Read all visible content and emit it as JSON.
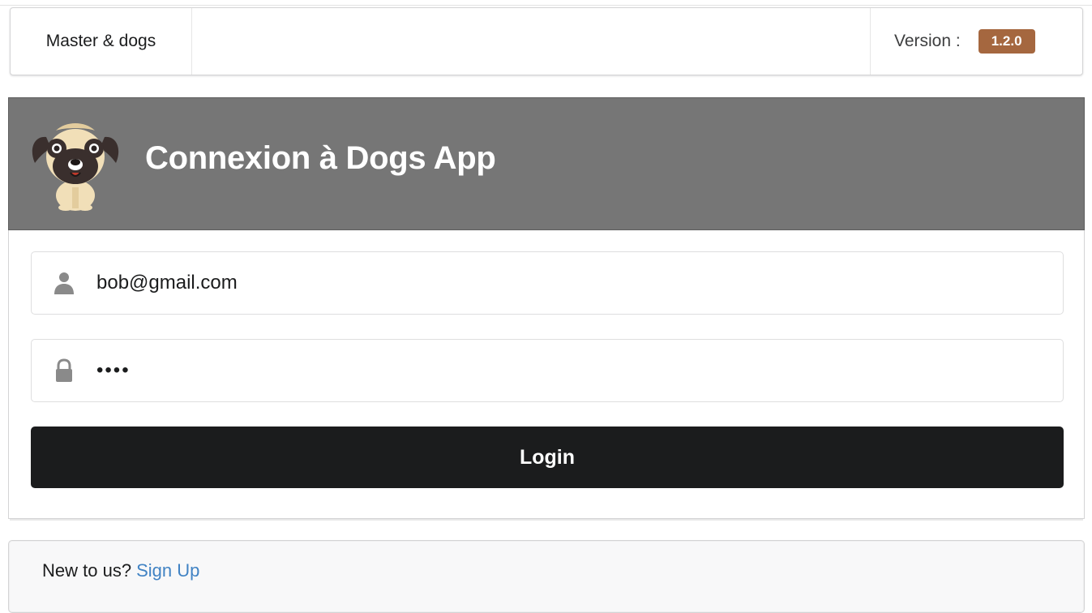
{
  "menu": {
    "brand": "Master & dogs",
    "version_label": "Version :",
    "version_value": "1.2.0"
  },
  "header": {
    "title": "Connexion à Dogs App",
    "logo_icon": "pug-logo"
  },
  "form": {
    "email": {
      "value": "bob@gmail.com",
      "icon": "user-icon"
    },
    "password": {
      "value": "abcd",
      "icon": "lock-icon"
    },
    "login_label": "Login"
  },
  "message": {
    "text": "New to us?",
    "link_label": "Sign Up"
  },
  "colors": {
    "header_bg": "#767676",
    "button_bg": "#1b1c1d",
    "badge_bg": "#a5673f",
    "link": "#4183c4"
  }
}
